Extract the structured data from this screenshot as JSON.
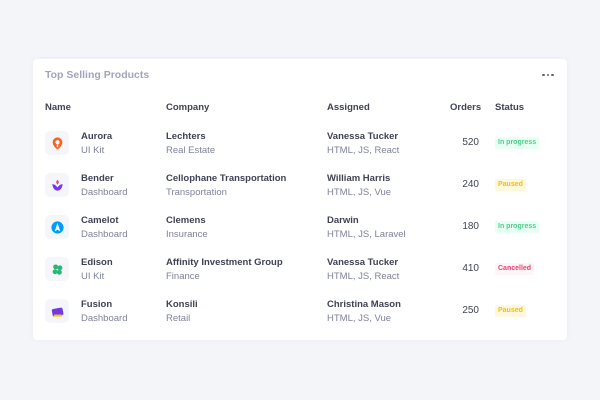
{
  "card": {
    "title": "Top Selling Products"
  },
  "headers": {
    "name": "Name",
    "company": "Company",
    "assigned": "Assigned",
    "orders": "Orders",
    "status": "Status"
  },
  "colors": {
    "in_progress_bg": "#e8fff3",
    "in_progress_fg": "#50cd89",
    "paused_bg": "#fff8dd",
    "paused_fg": "#f6c000",
    "cancelled_bg": "#fff5f8",
    "cancelled_fg": "#f1416c"
  },
  "rows": [
    {
      "icon": "aurora-logo-icon",
      "name": "Aurora",
      "type": "UI Kit",
      "company": "Lechters",
      "industry": "Real Estate",
      "assignee": "Vanessa Tucker",
      "skills": "HTML, JS, React",
      "orders": "520",
      "status": "In progress",
      "status_kind": "in_progress"
    },
    {
      "icon": "bender-logo-icon",
      "name": "Bender",
      "type": "Dashboard",
      "company": "Cellophane Transportation",
      "industry": "Transportation",
      "assignee": "William Harris",
      "skills": "HTML, JS, Vue",
      "orders": "240",
      "status": "Paused",
      "status_kind": "paused"
    },
    {
      "icon": "camelot-logo-icon",
      "name": "Camelot",
      "type": "Dashboard",
      "company": "Clemens",
      "industry": "Insurance",
      "assignee": "Darwin",
      "skills": "HTML, JS, Laravel",
      "orders": "180",
      "status": "In progress",
      "status_kind": "in_progress"
    },
    {
      "icon": "edison-logo-icon",
      "name": "Edison",
      "type": "UI Kit",
      "company": "Affinity Investment Group",
      "industry": "Finance",
      "assignee": "Vanessa Tucker",
      "skills": "HTML, JS, React",
      "orders": "410",
      "status": "Cancelled",
      "status_kind": "cancelled"
    },
    {
      "icon": "fusion-logo-icon",
      "name": "Fusion",
      "type": "Dashboard",
      "company": "Konsili",
      "industry": "Retail",
      "assignee": "Christina Mason",
      "skills": "HTML, JS, Vue",
      "orders": "250",
      "status": "Paused",
      "status_kind": "paused"
    }
  ]
}
